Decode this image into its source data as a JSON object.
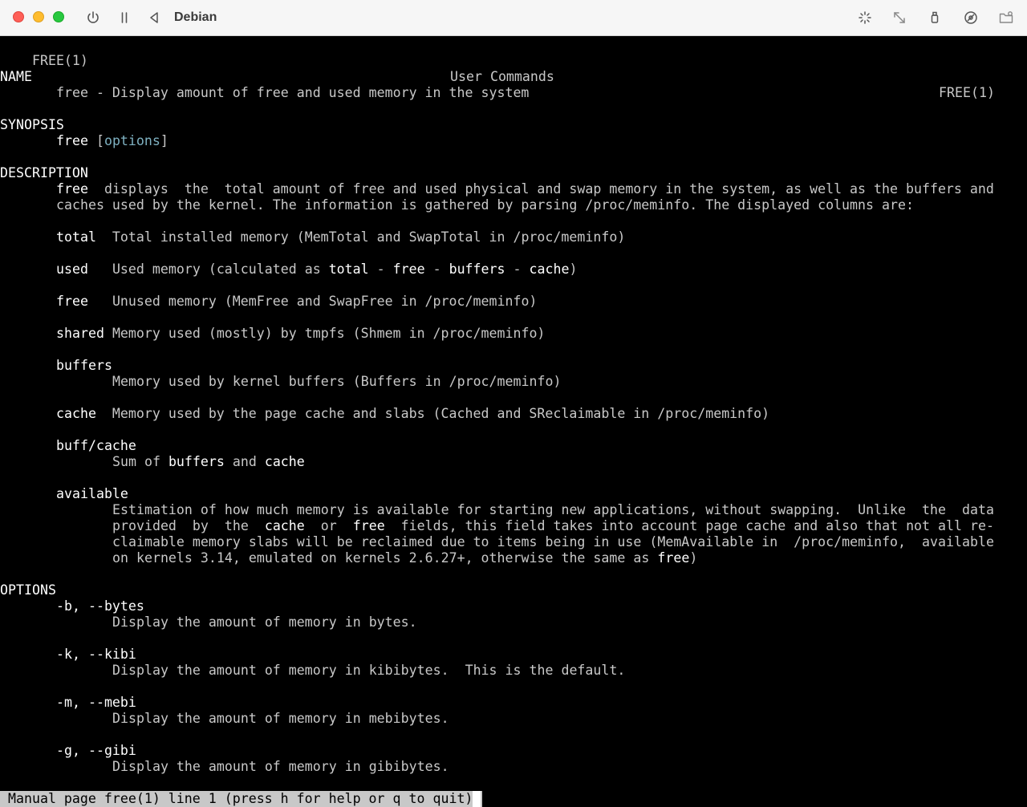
{
  "window": {
    "title": "Debian",
    "icons": [
      "power-icon",
      "pause-icon",
      "back-icon",
      "brightness-icon",
      "resize-icon",
      "usb-icon",
      "disc-icon",
      "folder-icon"
    ]
  },
  "man": {
    "header_left": "FREE(1)",
    "header_center": "User Commands",
    "header_right": "FREE(1)",
    "name_heading": "NAME",
    "name_text": "free - Display amount of free and used memory in the system",
    "synopsis_heading": "SYNOPSIS",
    "synopsis_cmd": "free",
    "synopsis_open": " [",
    "synopsis_opt": "options",
    "synopsis_close": "]",
    "description_heading": "DESCRIPTION",
    "desc1_b": "free",
    "desc1_rest": "  displays  the  total amount of free and used physical and swap memory in the system, as well as the buffers and",
    "desc2": "caches used by the kernel. The information is gathered by parsing /proc/meminfo. The displayed columns are:",
    "total_term": "total",
    "total_desc": "  Total installed memory (MemTotal and SwapTotal in /proc/meminfo)",
    "used_term": "used",
    "used_a": "   Used memory (calculated as ",
    "used_total": "total",
    "used_d1": " - ",
    "used_free": "free",
    "used_d2": " - ",
    "used_buffers": "buffers",
    "used_d3": " - ",
    "used_cache": "cache",
    "used_end": ")",
    "free_term": "free",
    "free_desc": "   Unused memory (MemFree and SwapFree in /proc/meminfo)",
    "shared_term": "shared",
    "shared_desc": " Memory used (mostly) by tmpfs (Shmem in /proc/meminfo)",
    "buffers_term": "buffers",
    "buffers_desc": "Memory used by kernel buffers (Buffers in /proc/meminfo)",
    "cache_term": "cache",
    "cache_desc": "  Memory used by the page cache and slabs (Cached and SReclaimable in /proc/meminfo)",
    "buffcache_term": "buff/cache",
    "buffcache_a": "Sum of ",
    "buffcache_b1": "buffers",
    "buffcache_and": " and ",
    "buffcache_b2": "cache",
    "available_term": "available",
    "avail1": "Estimation of how much memory is available for starting new applications, without swapping.  Unlike  the  data",
    "avail2_a": "provided  by  the  ",
    "avail2_cache": "cache",
    "avail2_or": "  or  ",
    "avail2_free": "free",
    "avail2_rest": "  fields, this field takes into account page cache and also that not all re-",
    "avail3": "claimable memory slabs will be reclaimed due to items being in use (MemAvailable in  /proc/meminfo,  available",
    "avail4_a": "on kernels 3.14, emulated on kernels 2.6.27+, otherwise the same as ",
    "avail4_free": "free",
    "avail4_end": ")",
    "options_heading": "OPTIONS",
    "opt_b_term": "-b, --bytes",
    "opt_b_desc": "Display the amount of memory in bytes.",
    "opt_k_term": "-k, --kibi",
    "opt_k_desc": "Display the amount of memory in kibibytes.  This is the default.",
    "opt_m_term": "-m, --mebi",
    "opt_m_desc": "Display the amount of memory in mebibytes.",
    "opt_g_term": "-g, --gibi",
    "opt_g_desc": "Display the amount of memory in gibibytes."
  },
  "status": {
    "text": " Manual page free(1) line 1 (press h for help or q to quit)"
  }
}
